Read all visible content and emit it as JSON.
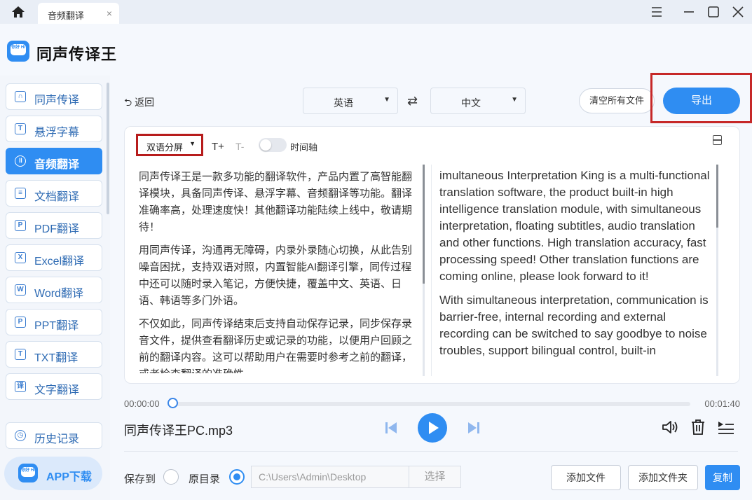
{
  "titlebar": {
    "tab_label": "音频翻译",
    "tab_close": "×"
  },
  "app": {
    "title": "同声传译王",
    "logo_text": "你好 Hi"
  },
  "sidebar": {
    "items": [
      {
        "label": "同声传译",
        "icon": "headset-icon",
        "glyph": "∩"
      },
      {
        "label": "悬浮字幕",
        "icon": "subtitle-icon",
        "glyph": "T"
      },
      {
        "label": "音频翻译",
        "icon": "audio-icon",
        "glyph": "॥"
      },
      {
        "label": "文档翻译",
        "icon": "document-icon",
        "glyph": "≡"
      },
      {
        "label": "PDF翻译",
        "icon": "pdf-icon",
        "glyph": "P"
      },
      {
        "label": "Excel翻译",
        "icon": "excel-icon",
        "glyph": "X"
      },
      {
        "label": "Word翻译",
        "icon": "word-icon",
        "glyph": "W"
      },
      {
        "label": "PPT翻译",
        "icon": "ppt-icon",
        "glyph": "P"
      },
      {
        "label": "TXT翻译",
        "icon": "txt-icon",
        "glyph": "T"
      },
      {
        "label": "文字翻译",
        "icon": "text-icon",
        "glyph": "译"
      }
    ],
    "active_index": 2,
    "history": {
      "label": "历史记录",
      "glyph": "◷"
    },
    "app_download": "APP下载",
    "collapse_glyph": "◀"
  },
  "toolbar": {
    "back_label": "返回",
    "back_glyph": "⮌",
    "source_lang": "英语",
    "target_lang": "中文",
    "caret": "▼",
    "swap_glyph": "⇄",
    "clear_label": "清空所有文件",
    "export_label": "导出"
  },
  "editor": {
    "mode_label": "双语分屏",
    "mode_caret": "▼",
    "font_up": "T+",
    "font_down": "T-",
    "timeline_label": "时间轴",
    "timeline_on": false,
    "source_paragraphs": [
      "同声传译王是一款多功能的翻译软件，产品内置了高智能翻译模块，具备同声传译、悬浮字幕、音频翻译等功能。翻译准确率高，处理速度快！其他翻译功能陆续上线中，敬请期待！",
      "用同声传译，沟通再无障碍，内录外录随心切换，从此告别噪音困扰，支持双语对照，内置智能AI翻译引擎，同传过程中还可以随时录入笔记，方便快捷，覆盖中文、英语、日语、韩语等多门外语。",
      "不仅如此，同声传译结束后支持自动保存记录，同步保存录音文件，提供查看翻译历史或记录的功能，以便用户回顾之前的翻译内容。这可以帮助用户在需要时参考之前的翻译，或者检查翻译的准确性。"
    ],
    "target_paragraphs": [
      "imultaneous Interpretation King is a multi-functional translation software, the product built-in high intelligence translation module, with simultaneous interpretation, floating subtitles, audio translation and other functions. High translation accuracy, fast processing speed! Other translation functions are coming online, please look forward to it!",
      "With simultaneous interpretation, communication is barrier-free, internal recording and external recording can be switched to say goodbye to noise troubles, support bilingual control, built-in"
    ]
  },
  "player": {
    "current_time": "00:00:00",
    "total_time": "00:01:40",
    "progress": 0.0,
    "file_name": "同声传译王PC.mp3"
  },
  "footer": {
    "save_to_label": "保存到",
    "original_dir_label": "原目录",
    "selected_option": "original_dir",
    "path_value": "C:\\Users\\Admin\\Desktop",
    "choose_label": "选择",
    "add_file_label": "添加文件",
    "add_folder_label": "添加文件夹",
    "copy_label": "复制"
  },
  "colors": {
    "accent": "#2f8df2",
    "highlight_frame": "#c62828"
  }
}
